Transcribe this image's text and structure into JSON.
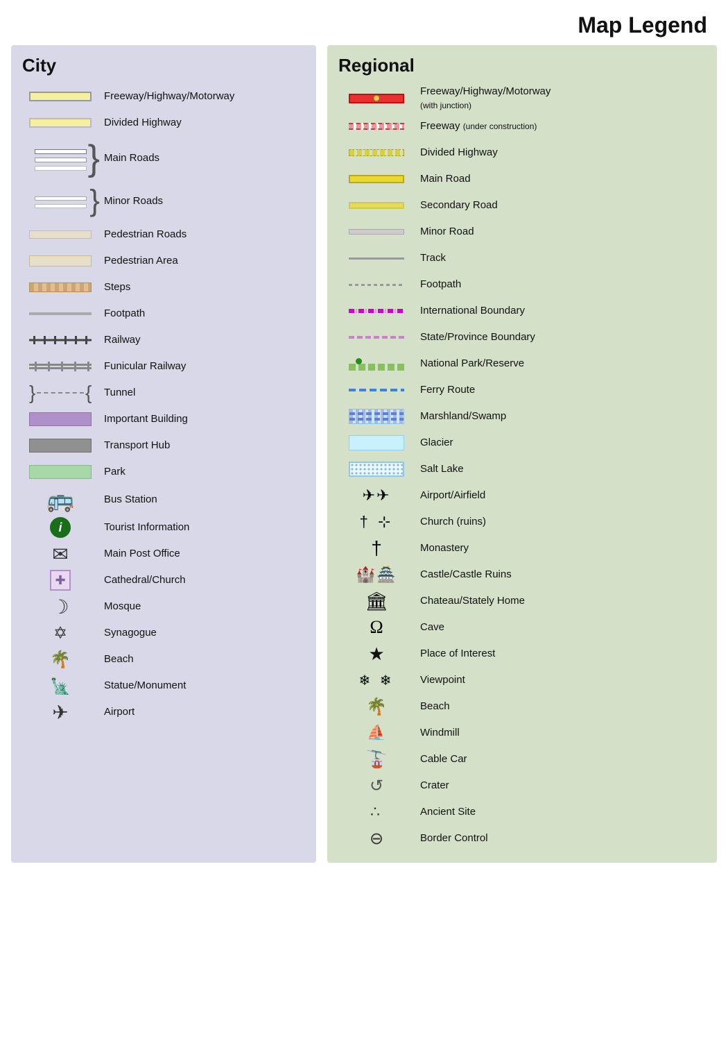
{
  "page": {
    "title": "Map Legend"
  },
  "city": {
    "title": "City",
    "items": [
      {
        "id": "freeway",
        "label": "Freeway/Highway/Motorway",
        "type": "road-freeway"
      },
      {
        "id": "divided-hwy",
        "label": "Divided Highway",
        "type": "road-divided"
      },
      {
        "id": "main-roads",
        "label": "Main Roads",
        "type": "road-main"
      },
      {
        "id": "minor-roads",
        "label": "Minor Roads",
        "type": "road-minor"
      },
      {
        "id": "pedestrian-roads",
        "label": "Pedestrian Roads",
        "type": "road-pedestrian"
      },
      {
        "id": "pedestrian-area",
        "label": "Pedestrian Area",
        "type": "road-ped-area"
      },
      {
        "id": "steps",
        "label": "Steps",
        "type": "road-steps"
      },
      {
        "id": "footpath",
        "label": "Footpath",
        "type": "road-footpath"
      },
      {
        "id": "railway",
        "label": "Railway",
        "type": "road-railway"
      },
      {
        "id": "funicular",
        "label": "Funicular Railway",
        "type": "road-funicular"
      },
      {
        "id": "tunnel",
        "label": "Tunnel",
        "type": "tunnel"
      },
      {
        "id": "important-building",
        "label": "Important Building",
        "type": "building-important"
      },
      {
        "id": "transport-hub",
        "label": "Transport Hub",
        "type": "building-transport"
      },
      {
        "id": "park",
        "label": "Park",
        "type": "park"
      },
      {
        "id": "bus-station",
        "label": "Bus Station",
        "type": "icon",
        "icon": "🚌"
      },
      {
        "id": "tourist-info",
        "label": "Tourist Information",
        "type": "info"
      },
      {
        "id": "main-post",
        "label": "Main Post Office",
        "type": "icon",
        "icon": "✉"
      },
      {
        "id": "cathedral",
        "label": "Cathedral/Church",
        "type": "church"
      },
      {
        "id": "mosque",
        "label": "Mosque",
        "type": "icon",
        "icon": "☽"
      },
      {
        "id": "synagogue",
        "label": "Synagogue",
        "type": "icon",
        "icon": "✡"
      },
      {
        "id": "beach",
        "label": "Beach",
        "type": "icon",
        "icon": "⛱"
      },
      {
        "id": "statue",
        "label": "Statue/Monument",
        "type": "icon",
        "icon": "🗿"
      },
      {
        "id": "airport",
        "label": "Airport",
        "type": "icon",
        "icon": "✈"
      }
    ]
  },
  "regional": {
    "title": "Regional",
    "items": [
      {
        "id": "reg-freeway",
        "label": "Freeway/Highway/Motorway",
        "sublabel": "(with junction)",
        "type": "reg-freeway"
      },
      {
        "id": "reg-freeway-const",
        "label": "Freeway (under construction)",
        "type": "reg-freeway-construct"
      },
      {
        "id": "reg-divided",
        "label": "Divided Highway",
        "type": "reg-divided"
      },
      {
        "id": "reg-main",
        "label": "Main Road",
        "type": "reg-mainroad"
      },
      {
        "id": "reg-secondary",
        "label": "Secondary Road",
        "type": "reg-secondary"
      },
      {
        "id": "reg-minor",
        "label": "Minor Road",
        "type": "reg-minor"
      },
      {
        "id": "reg-track",
        "label": "Track",
        "type": "reg-track"
      },
      {
        "id": "reg-footpath",
        "label": "Footpath",
        "type": "reg-footpath"
      },
      {
        "id": "intl-boundary",
        "label": "International Boundary",
        "type": "reg-intl-boundary"
      },
      {
        "id": "state-boundary",
        "label": "State/Province Boundary",
        "type": "reg-state-boundary"
      },
      {
        "id": "national-park",
        "label": "National Park/Reserve",
        "type": "national-park"
      },
      {
        "id": "ferry-route",
        "label": "Ferry Route",
        "type": "ferry-route"
      },
      {
        "id": "marshland",
        "label": "Marshland/Swamp",
        "type": "marshland"
      },
      {
        "id": "glacier",
        "label": "Glacier",
        "type": "glacier"
      },
      {
        "id": "salt-lake",
        "label": "Salt Lake",
        "type": "salt-lake"
      },
      {
        "id": "airport-airfield",
        "label": "Airport/Airfield",
        "type": "symbol",
        "icon": "✈✈"
      },
      {
        "id": "church-ruins",
        "label": "Church (ruins)",
        "type": "symbol",
        "icon": "†⊹"
      },
      {
        "id": "monastery",
        "label": "Monastery",
        "type": "symbol",
        "icon": "†"
      },
      {
        "id": "castle",
        "label": "Castle/Castle Ruins",
        "type": "symbol",
        "icon": "🏰🏯"
      },
      {
        "id": "chateau",
        "label": "Chateau/Stately Home",
        "type": "symbol",
        "icon": "🏛"
      },
      {
        "id": "cave",
        "label": "Cave",
        "type": "symbol",
        "icon": "Ω"
      },
      {
        "id": "place-interest",
        "label": "Place of Interest",
        "type": "symbol",
        "icon": "★"
      },
      {
        "id": "viewpoint",
        "label": "Viewpoint",
        "type": "symbol",
        "icon": "❄ ❄"
      },
      {
        "id": "beach-reg",
        "label": "Beach",
        "type": "symbol",
        "icon": "⛱"
      },
      {
        "id": "windmill",
        "label": "Windmill",
        "type": "symbol",
        "icon": "⛵"
      },
      {
        "id": "cable-car",
        "label": "Cable Car",
        "type": "symbol",
        "icon": "🚡"
      },
      {
        "id": "crater",
        "label": "Crater",
        "type": "symbol",
        "icon": "⟲"
      },
      {
        "id": "ancient-site",
        "label": "Ancient Site",
        "type": "symbol",
        "icon": "∴"
      },
      {
        "id": "border-control",
        "label": "Border Control",
        "type": "symbol",
        "icon": "⊖"
      }
    ]
  }
}
